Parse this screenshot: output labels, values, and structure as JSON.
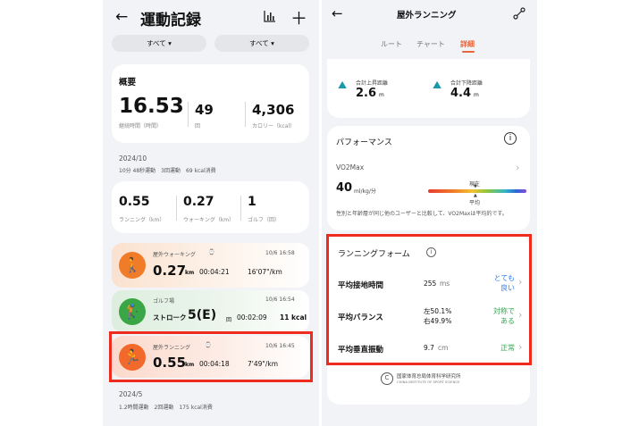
{
  "left": {
    "title": "運動記録",
    "filter1": "すべて",
    "filter2": "すべて",
    "summary": {
      "title": "概要",
      "duration_value": "16.53",
      "duration_label": "継続時間（時間）",
      "count_value": "49",
      "count_label": "回",
      "calories_value": "4,306",
      "calories_label": "カロリー（kcal）"
    },
    "month1": {
      "label": "2024/10",
      "stats": "10分 48秒運動　3回運動　69 kcal消費",
      "running_value": "0.55",
      "running_label": "ランニング（km）",
      "walking_value": "0.27",
      "walking_label": "ウォーキング（km）",
      "golf_value": "1",
      "golf_label": "ゴルフ（回）"
    },
    "activities": [
      {
        "name": "屋外ウォーキング",
        "date": "10/6 16:58",
        "distance": "0.27",
        "unit": "km",
        "time": "00:04:21",
        "pace": "16'07\"/km"
      },
      {
        "name": "ゴルフ場",
        "date": "10/6 16:54",
        "strokes_label": "ストローク",
        "strokes_value": "5(E)",
        "strokes_unit": "回",
        "time": "00:02:09",
        "calories": "11 kcal"
      },
      {
        "name": "屋外ランニング",
        "date": "10/6 16:45",
        "distance": "0.55",
        "unit": "km",
        "time": "00:04:18",
        "pace": "7'49\"/km"
      }
    ],
    "month2": {
      "label": "2024/5",
      "stats": "1.2時間運動　2回運動　175 kcal消費"
    }
  },
  "right": {
    "title": "屋外ランニング",
    "tabs": [
      "ルート",
      "チャート",
      "詳細"
    ],
    "active_tab": "詳細",
    "ascent_label": "合計上昇距離",
    "ascent_value": "2.6",
    "ascent_unit": "m",
    "descent_label": "合計下降距離",
    "descent_value": "4.4",
    "descent_unit": "m",
    "performance": {
      "title": "パフォーマンス",
      "vo2_label": "VO2Max",
      "vo2_value": "40",
      "vo2_unit": "ml/kg/分",
      "current_label": "現在",
      "average_label": "平均",
      "note": "性別と年齢層が同じ他のユーザーと比較して、VO2Maxは平均的です。"
    },
    "form": {
      "title": "ランニングフォーム",
      "rows": [
        {
          "label": "平均接地時間",
          "value": "255",
          "unit": "ms",
          "status": "とても良い"
        },
        {
          "label": "平均バランス",
          "value_left": "左50.1%",
          "value_right": "右49.9%",
          "status": "対称である"
        },
        {
          "label": "平均垂直振動",
          "value": "9.7",
          "unit": "cm",
          "status": "正常"
        }
      ]
    },
    "logo_text": "国家体育总局体育科学研究所",
    "logo_subtext": "CHINA INSTITUTE OF SPORT SCIENCE"
  },
  "colors": {
    "accent_red": "#ee2b1c",
    "tab_active": "#e8643a",
    "status_blue": "#2f7be6",
    "status_green": "#3aa655",
    "walk_orange": "#f07c2a",
    "golf_green": "#3aa645",
    "run_orange": "#f26a2b"
  }
}
